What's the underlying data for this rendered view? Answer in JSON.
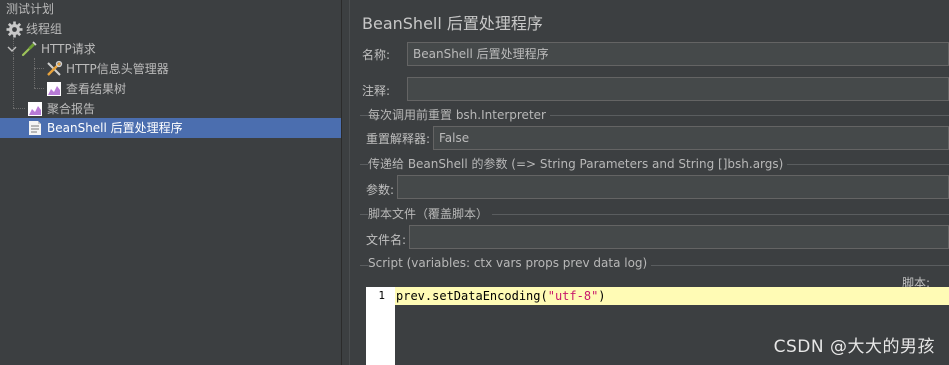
{
  "tree": {
    "items": [
      {
        "label": "测试计划"
      },
      {
        "label": "线程组"
      },
      {
        "label": "HTTP请求"
      },
      {
        "label": "HTTP信息头管理器"
      },
      {
        "label": "查看结果树"
      },
      {
        "label": "聚合报告"
      },
      {
        "label": "BeanShell 后置处理程序"
      }
    ]
  },
  "panel": {
    "title": "BeanShell 后置处理程序",
    "name_label": "名称:",
    "name_value": "BeanShell 后置处理程序",
    "comment_label": "注释:",
    "comment_value": "",
    "reset_group_title": "每次调用前重置 bsh.Interpreter",
    "reset_label": "重置解释器:",
    "reset_value": "False",
    "params_group_title": "传递给 BeanShell 的参数 (=> String Parameters and String []bsh.args)",
    "params_label": "参数:",
    "params_value": "",
    "file_group_title": "脚本文件（覆盖脚本）",
    "file_label": "文件名:",
    "file_value": "",
    "script_group_title": "Script (variables: ctx vars props prev data log)",
    "script_label": "脚本:",
    "script": {
      "line_number": "1",
      "code_prefix": "prev.setDataEncoding(",
      "code_string": "\"utf-8\"",
      "code_suffix": ")"
    }
  },
  "watermark": "CSDN @大大的男孩",
  "icons": {
    "gear": "gear-icon",
    "pipette": "http-request-icon",
    "wrench": "header-manager-icon",
    "chart": "chart-icon",
    "script": "script-icon",
    "expand": "chevron-down-icon"
  },
  "colors": {
    "background": "#3c3f41",
    "selection": "#4b6eaf",
    "current_line": "#fffbb5",
    "string": "#c8186b"
  }
}
